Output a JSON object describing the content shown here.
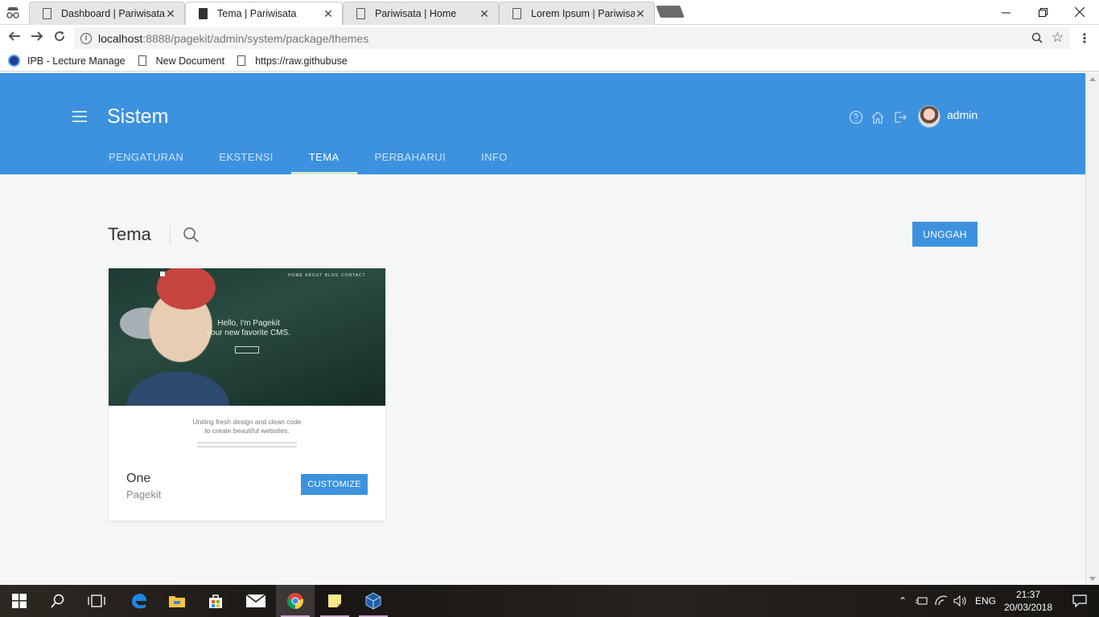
{
  "browser": {
    "tabs": [
      {
        "title": "Dashboard | Pariwisata",
        "active": false
      },
      {
        "title": "Tema | Pariwisata",
        "active": true
      },
      {
        "title": "Pariwisata | Home",
        "active": false
      },
      {
        "title": "Lorem Ipsum | Pariwisata",
        "active": false
      }
    ],
    "url_host": "localhost",
    "url_path": ":8888/pagekit/admin/system/package/themes",
    "bookmarks": [
      {
        "label": "IPB - Lecture Manage",
        "icon": "ipb-logo-icon"
      },
      {
        "label": "New Document",
        "icon": "document-icon"
      },
      {
        "label": "https://raw.githubuse",
        "icon": "document-icon"
      }
    ]
  },
  "header": {
    "title": "Sistem",
    "username": "admin",
    "nav": [
      {
        "label": "PENGATURAN",
        "active": false
      },
      {
        "label": "EKSTENSI",
        "active": false
      },
      {
        "label": "TEMA",
        "active": true
      },
      {
        "label": "PERBAHARUI",
        "active": false
      },
      {
        "label": "INFO",
        "active": false
      }
    ]
  },
  "main": {
    "section_title": "Tema",
    "upload_label": "UNGGAH",
    "themes": [
      {
        "name": "One",
        "author": "Pagekit",
        "customize_label": "CUSTOMIZE",
        "preview": {
          "hero_line1": "Hello, I'm Pagekit",
          "hero_line2": "your new favorite CMS.",
          "tagline_line1": "Uniting fresh design and clean code",
          "tagline_line2": "to create beautiful websites.",
          "nav": "HOME  ABOUT  BLOG  CONTACT"
        }
      }
    ]
  },
  "taskbar": {
    "language": "ENG",
    "time": "21:37",
    "date": "20/03/2018"
  },
  "colors": {
    "accent": "#3c92de",
    "active_tab_underline": "#d7ecc6",
    "page_bg": "#f5f6f8"
  }
}
